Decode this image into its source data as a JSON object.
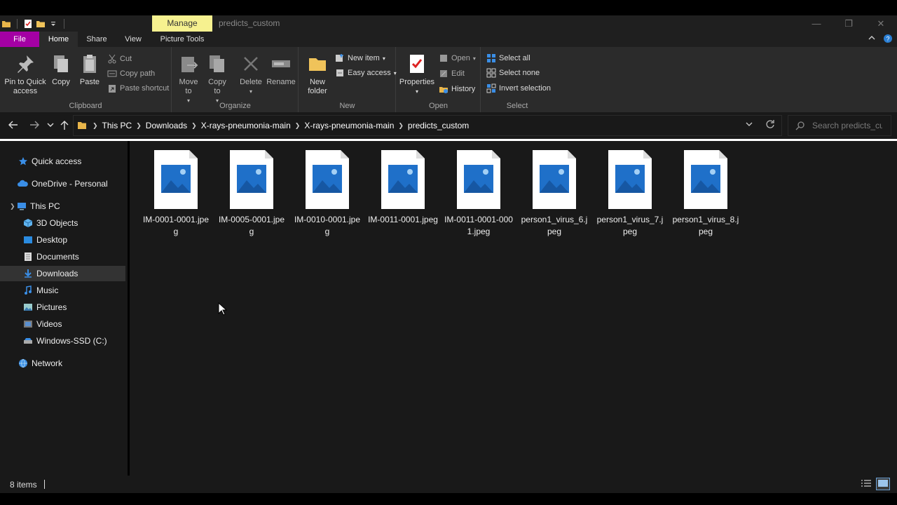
{
  "window": {
    "title": "predicts_custom",
    "context_tab": "Manage",
    "minimize_glyph": "—",
    "restore_glyph": "❐",
    "close_glyph": "✕"
  },
  "tabs": {
    "file": "File",
    "home": "Home",
    "share": "Share",
    "view": "View",
    "picture_tools": "Picture Tools"
  },
  "ribbon": {
    "clipboard": {
      "label": "Clipboard",
      "pin": "Pin to Quick access",
      "copy": "Copy",
      "paste": "Paste",
      "cut": "Cut",
      "copy_path": "Copy path",
      "paste_shortcut": "Paste shortcut"
    },
    "organize": {
      "label": "Organize",
      "move_to": "Move to",
      "copy_to": "Copy to",
      "delete": "Delete",
      "rename": "Rename"
    },
    "new": {
      "label": "New",
      "new_folder": "New folder",
      "new_item": "New item",
      "easy_access": "Easy access"
    },
    "open": {
      "label": "Open",
      "properties": "Properties",
      "open": "Open",
      "edit": "Edit",
      "history": "History"
    },
    "select": {
      "label": "Select",
      "select_all": "Select all",
      "select_none": "Select none",
      "invert_selection": "Invert selection"
    }
  },
  "address": {
    "crumbs": [
      "This PC",
      "Downloads",
      "X-rays-pneumonia-main",
      "X-rays-pneumonia-main",
      "predicts_custom"
    ],
    "search_placeholder": "Search predicts_cu..."
  },
  "nav": {
    "items": [
      {
        "label": "Quick access",
        "icon": "star-icon"
      },
      {
        "label": "OneDrive - Personal",
        "icon": "cloud-icon"
      },
      {
        "label": "This PC",
        "icon": "computer-icon"
      },
      {
        "label": "3D Objects",
        "icon": "cube-icon"
      },
      {
        "label": "Desktop",
        "icon": "desktop-icon"
      },
      {
        "label": "Documents",
        "icon": "document-icon"
      },
      {
        "label": "Downloads",
        "icon": "download-icon"
      },
      {
        "label": "Music",
        "icon": "music-icon"
      },
      {
        "label": "Pictures",
        "icon": "pictures-icon"
      },
      {
        "label": "Videos",
        "icon": "videos-icon"
      },
      {
        "label": "Windows-SSD (C:)",
        "icon": "drive-icon"
      },
      {
        "label": "Network",
        "icon": "network-icon"
      }
    ],
    "selected": "Downloads"
  },
  "files": [
    {
      "name": "IM-0001-0001.jpeg"
    },
    {
      "name": "IM-0005-0001.jpeg"
    },
    {
      "name": "IM-0010-0001.jpeg"
    },
    {
      "name": "IM-0011-0001.jpeg"
    },
    {
      "name": "IM-0011-0001-0001.jpeg"
    },
    {
      "name": "person1_virus_6.jpeg"
    },
    {
      "name": "person1_virus_7.jpeg"
    },
    {
      "name": "person1_virus_8.jpeg"
    }
  ],
  "status": {
    "item_count": "8 items"
  },
  "colors": {
    "file_tab": "#a400a4",
    "manage_tab": "#f6f18f",
    "accent_blue": "#3a8ee6",
    "background": "#191919"
  }
}
